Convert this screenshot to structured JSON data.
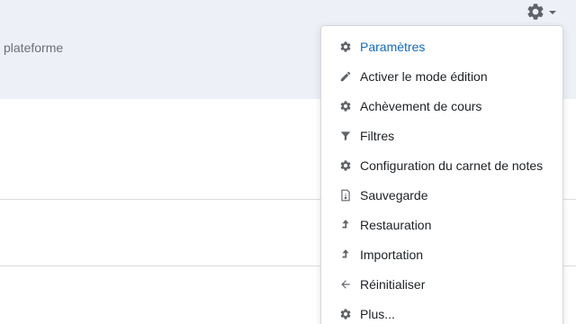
{
  "header": {
    "breadcrumb_fragment": "plateforme"
  },
  "settings_menu": {
    "toggle_icon": "gear-icon",
    "items": [
      {
        "label": "Paramètres",
        "icon": "gear-icon",
        "active": true
      },
      {
        "label": "Activer le mode édition",
        "icon": "pencil-icon"
      },
      {
        "label": "Achèvement de cours",
        "icon": "gear-icon"
      },
      {
        "label": "Filtres",
        "icon": "filter-icon"
      },
      {
        "label": "Configuration du carnet de notes",
        "icon": "gear-icon"
      },
      {
        "label": "Sauvegarde",
        "icon": "backup-file-icon"
      },
      {
        "label": "Restauration",
        "icon": "upload-icon"
      },
      {
        "label": "Importation",
        "icon": "upload-icon"
      },
      {
        "label": "Réinitialiser",
        "icon": "arrow-left-icon"
      },
      {
        "label": "Plus...",
        "icon": "gear-icon"
      }
    ]
  },
  "colors": {
    "header_background": "#eef0f8",
    "active_link": "#0f6cbf",
    "text": "#1d2125",
    "icon": "#5f6368"
  }
}
